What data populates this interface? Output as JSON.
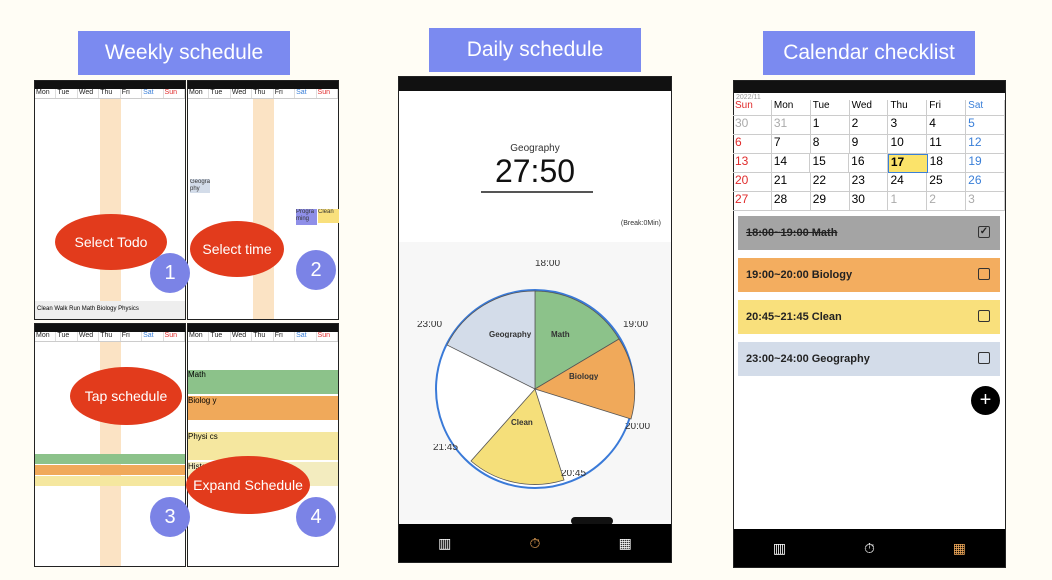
{
  "headers": {
    "weekly": "Weekly schedule",
    "daily": "Daily schedule",
    "calendar": "Calendar checklist"
  },
  "weekdays": [
    "Mon",
    "Tue",
    "Wed",
    "Thu",
    "Fri",
    "Sat",
    "Sun"
  ],
  "bubbles": {
    "select_todo": "Select Todo",
    "select_time": "Select time",
    "tap_schedule": "Tap schedule",
    "expand_schedule": "Expand Schedule"
  },
  "steps": [
    "1",
    "2",
    "3",
    "4"
  ],
  "daily": {
    "subject": "Geography",
    "timer": "27:50",
    "break": "(Break:0Min)",
    "time_labels": {
      "t1800": "18:00",
      "t1900": "19:00",
      "t2000": "20:00",
      "t2045": "20:45",
      "t2145": "21:45",
      "t2300": "23:00"
    }
  },
  "pie": [
    {
      "label": "Math",
      "color": "#8cc28a"
    },
    {
      "label": "Biology",
      "color": "#f0a95a"
    },
    {
      "label": "Clean",
      "color": "#f5df7a"
    },
    {
      "label": "Geography",
      "color": "#d3dce9"
    }
  ],
  "calendar": {
    "month": "2022/11",
    "weekdays": [
      "Sun",
      "Mon",
      "Tue",
      "Wed",
      "Thu",
      "Fri",
      "Sat"
    ],
    "rows": [
      [
        "30",
        "31",
        "1",
        "2",
        "3",
        "4",
        "5"
      ],
      [
        "6",
        "7",
        "8",
        "9",
        "10",
        "11",
        "12"
      ],
      [
        "13",
        "14",
        "15",
        "16",
        "17",
        "18",
        "19"
      ],
      [
        "20",
        "21",
        "22",
        "23",
        "24",
        "25",
        "26"
      ],
      [
        "27",
        "28",
        "29",
        "30",
        "1",
        "2",
        "3"
      ]
    ]
  },
  "todos": [
    {
      "text": "18:00~19:00 Math",
      "color": "#a4a4a4",
      "done": true
    },
    {
      "text": "19:00~20:00 Biology",
      "color": "#f3ad5f",
      "done": false
    },
    {
      "text": "20:45~21:45 Clean",
      "color": "#f9e07c",
      "done": false
    },
    {
      "text": "23:00~24:00 Geography",
      "color": "#d3dce9",
      "done": false
    }
  ],
  "icons": {
    "table": "▥",
    "timer": "⏱",
    "calendar": "▦",
    "plus": "+",
    "minus": "−"
  },
  "mini": {
    "math": "Math",
    "biology": "Biolog y",
    "physics": "Physi cs",
    "clean": "Clean",
    "history": "Histor y",
    "geography": "Geogra phy",
    "programming": "Progra ming"
  }
}
